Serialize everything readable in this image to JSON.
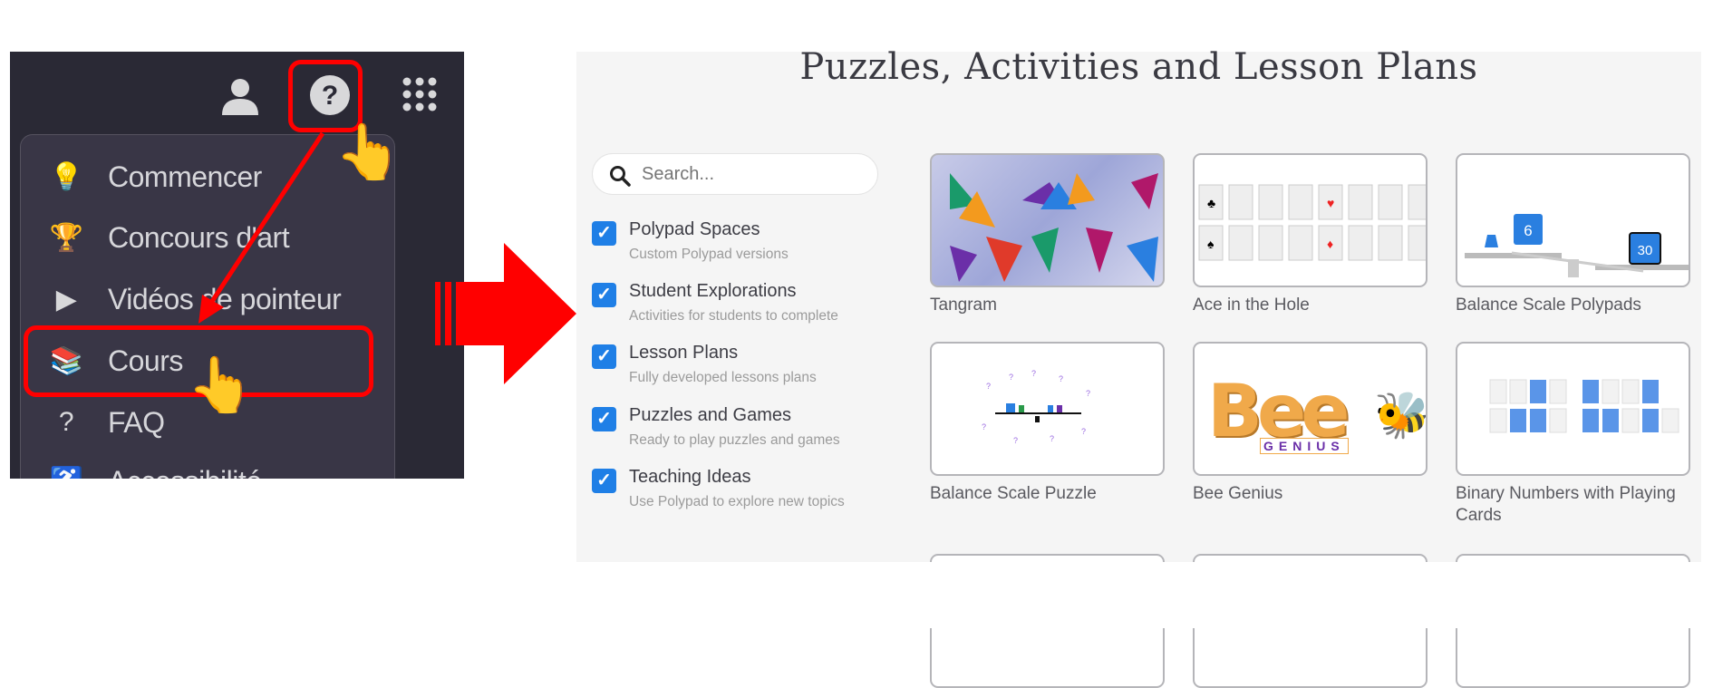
{
  "left_panel": {
    "header_icons": [
      "person-icon",
      "help-circle-icon",
      "apps-grid-icon"
    ],
    "menu_items": [
      {
        "label": "Commencer",
        "icon": "lightbulb-icon"
      },
      {
        "label": "Concours d'art",
        "icon": "trophy-icon"
      },
      {
        "label": "Vidéos de pointeur",
        "icon": "video-play-icon"
      },
      {
        "label": "Cours",
        "icon": "books-icon"
      },
      {
        "label": "FAQ",
        "icon": "help-circle-icon"
      },
      {
        "label": "Accessibilité",
        "icon": "accessibility-icon"
      }
    ],
    "highlight_color": "#ff0000"
  },
  "right_panel": {
    "title": "Puzzles, Activities and Lesson Plans",
    "search": {
      "placeholder": "Search...",
      "value": ""
    },
    "filters": [
      {
        "label": "Polypad Spaces",
        "sub": "Custom Polypad versions",
        "checked": true
      },
      {
        "label": "Student Explorations",
        "sub": "Activities for students to complete",
        "checked": true
      },
      {
        "label": "Lesson Plans",
        "sub": "Fully developed lessons plans",
        "checked": true
      },
      {
        "label": "Puzzles and Games",
        "sub": "Ready to play puzzles and games",
        "checked": true
      },
      {
        "label": "Teaching Ideas",
        "sub": "Use Polypad to explore new topics",
        "checked": true
      }
    ],
    "cards": [
      {
        "title": "Tangram"
      },
      {
        "title": "Ace in the Hole"
      },
      {
        "title": "Balance Scale Polypads",
        "thumb_values": [
          "6",
          "30"
        ]
      },
      {
        "title": "Balance Scale Puzzle"
      },
      {
        "title": "Bee Genius",
        "thumb_text": "Bee",
        "thumb_sub": "GENIUS"
      },
      {
        "title": "Binary Numbers with Playing Cards"
      }
    ],
    "accent_color": "#1f7fe6"
  }
}
